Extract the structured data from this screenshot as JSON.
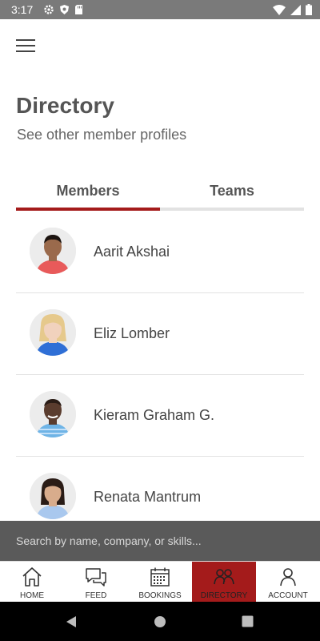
{
  "status_bar": {
    "time": "3:17"
  },
  "header": {
    "title": "Directory",
    "subtitle": "See other member profiles"
  },
  "tabs": [
    {
      "label": "Members",
      "active": true
    },
    {
      "label": "Teams",
      "active": false
    }
  ],
  "members": [
    {
      "name": "Aarit Akshai",
      "avatar_shirt": "#e85a5a",
      "avatar_skin": "#9a6a4c"
    },
    {
      "name": "Eliz Lomber",
      "avatar_shirt": "#2f6fd6",
      "avatar_skin": "#f1d2bd"
    },
    {
      "name": "Kieram Graham G.",
      "avatar_shirt": "#6fb4e6",
      "avatar_skin": "#5a3c2e"
    },
    {
      "name": "Renata Mantrum",
      "avatar_shirt": "#a9c8ee",
      "avatar_skin": "#d8ac8c"
    }
  ],
  "search": {
    "placeholder": "Search by name, company, or skills..."
  },
  "bottom_nav": [
    {
      "label": "HOME",
      "icon": "home-icon"
    },
    {
      "label": "FEED",
      "icon": "chat-bubbles-icon"
    },
    {
      "label": "BOOKINGS",
      "icon": "calendar-icon"
    },
    {
      "label": "DIRECTORY",
      "icon": "people-icon",
      "active": true
    },
    {
      "label": "ACCOUNT",
      "icon": "person-icon"
    }
  ],
  "colors": {
    "accent": "#a41b1b",
    "inactive_tab_bar": "#e2e2e2",
    "status_bar": "#7a7a7a",
    "search_bar": "#5a5a5a"
  }
}
